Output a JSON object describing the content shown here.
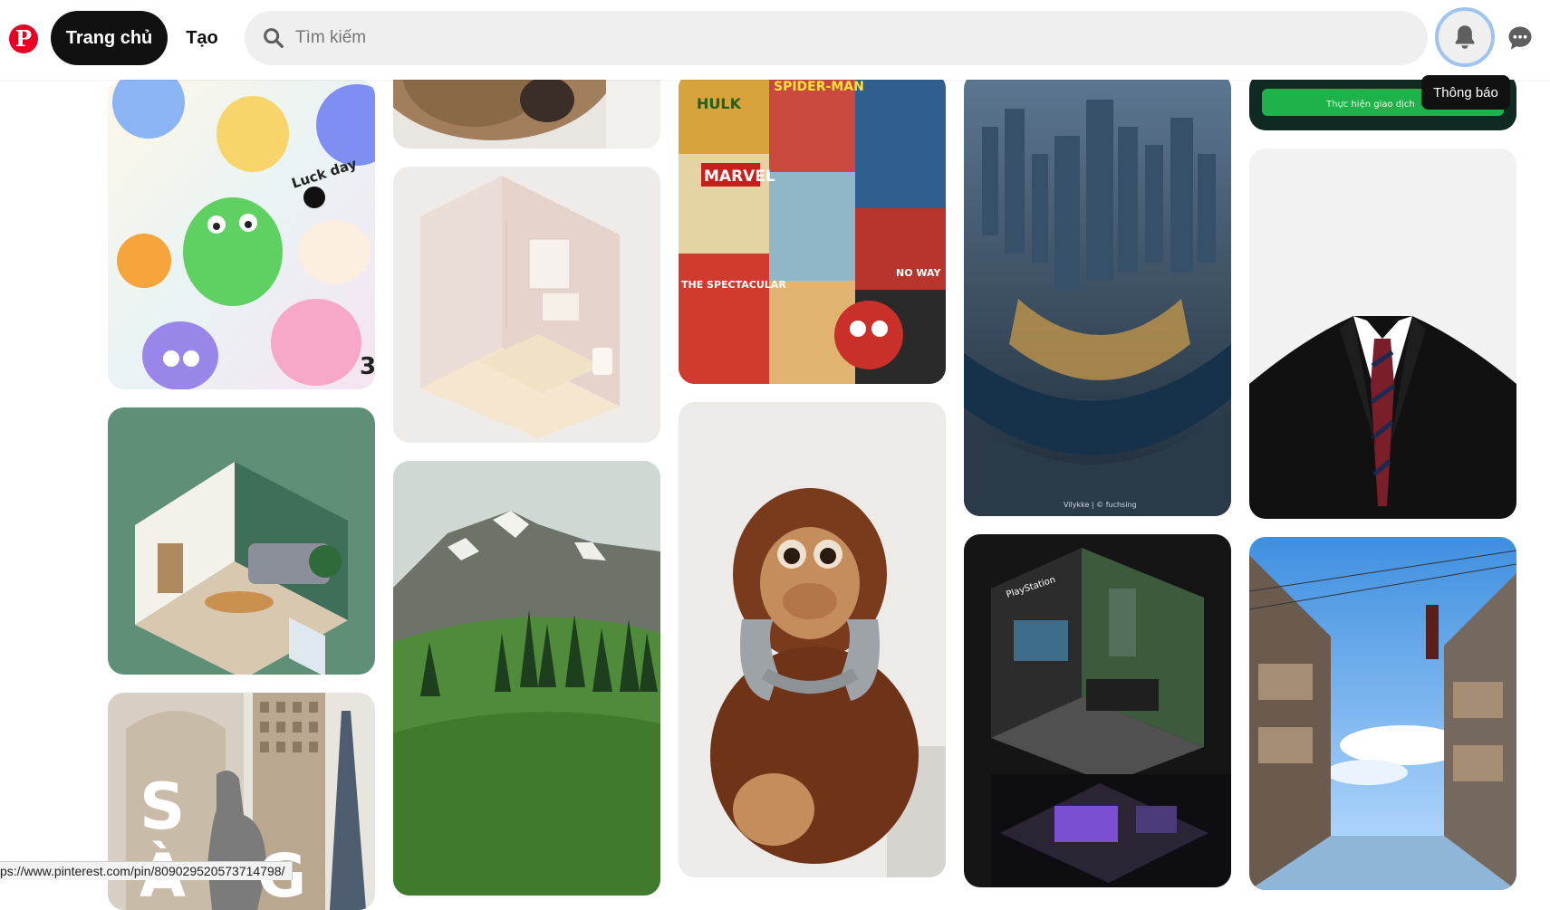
{
  "header": {
    "logo_letter": "P",
    "nav": {
      "home_label": "Trang chủ",
      "create_label": "Tạo"
    },
    "search": {
      "placeholder": "Tìm kiếm",
      "value": ""
    },
    "notifications_tooltip": "Thông báo"
  },
  "pins": [
    {
      "id": "pin-cute-stickers",
      "texts": [
        "Luck day",
        "3"
      ]
    },
    {
      "id": "pin-iso-living-room",
      "texts": []
    },
    {
      "id": "pin-saigon",
      "texts": [
        "S",
        "À",
        "G"
      ]
    },
    {
      "id": "pin-hair-closeup",
      "texts": []
    },
    {
      "id": "pin-iso-bathroom",
      "texts": []
    },
    {
      "id": "pin-mountain-meadow",
      "texts": []
    },
    {
      "id": "pin-marvel-comics",
      "texts": [
        "MARVEL",
        "SPIDER-MAN",
        "HULK",
        "THE SPECTACULAR",
        "NO WAY"
      ]
    },
    {
      "id": "pin-monkey-headphones",
      "texts": []
    },
    {
      "id": "pin-city-aerial",
      "texts": [
        "Vilykke | © fuchsing"
      ]
    },
    {
      "id": "pin-iso-gaming-room",
      "texts": [
        "PlayStation"
      ]
    },
    {
      "id": "pin-banner-green",
      "texts": [
        "Thực hiện giao dịch"
      ]
    },
    {
      "id": "pin-suit-template",
      "texts": []
    },
    {
      "id": "pin-japan-street",
      "texts": []
    }
  ],
  "status_bar": {
    "url": "ps://www.pinterest.com/pin/809029520573714798/"
  },
  "colors": {
    "brand": "#e60023",
    "nav_active_bg": "#111111",
    "search_bg": "#efefef",
    "focus_ring": "#9fc4ee"
  }
}
